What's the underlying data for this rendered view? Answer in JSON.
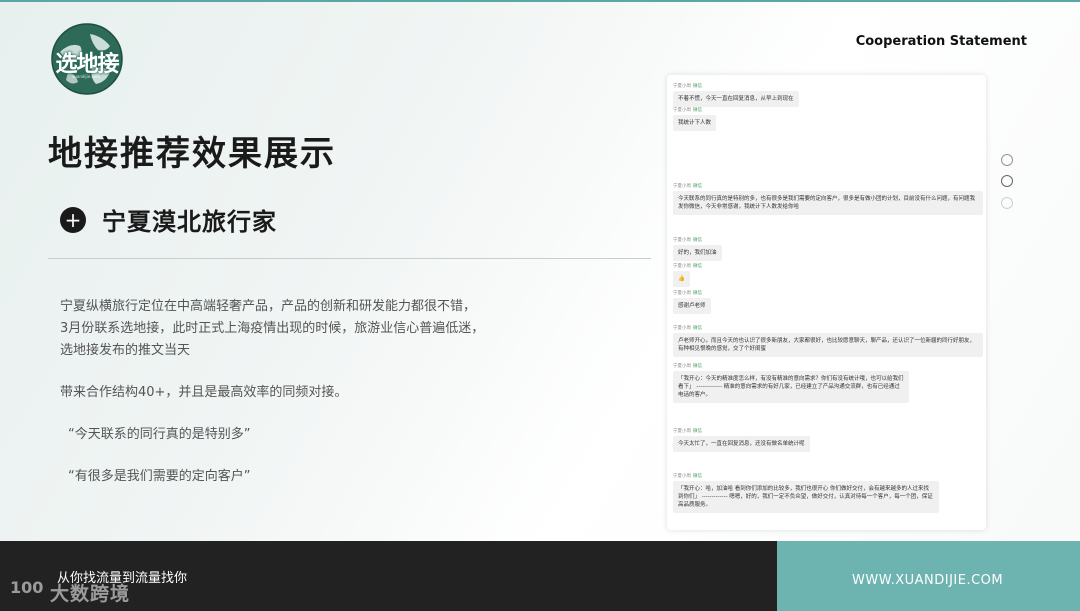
{
  "brand": {
    "logo_text": "选地接",
    "logo_subtext": "xuandijie.com",
    "colors": {
      "accent": "#6db3b0",
      "logo_green": "#2d6a58",
      "footer_dark": "#222222"
    }
  },
  "header": {
    "statement": "Cooperation Statement"
  },
  "main": {
    "title": "地接推荐效果展示",
    "subtitle": "宁夏漠北旅行家",
    "subtitle_icon": "plus-icon",
    "paragraphs": [
      "宁夏纵横旅行定位在中高端轻奢产品，产品的创新和研发能力都很不错，",
      "3月份联系选地接，此时正式上海疫情出现的时候，旅游业信心普遍低迷，",
      "选地接发布的推文当天"
    ],
    "summary": "带来合作结构40+，并且是最高效率的同频对接。",
    "quotes": [
      "“今天联系的同行真的是特别多”",
      "“有很多是我们需要的定向客户”"
    ]
  },
  "chat": {
    "messages": [
      {
        "sender": "宁夏小周",
        "tag": "微信",
        "text": "不着不慌，今天一直在回复消息，从早上到现在"
      },
      {
        "sender": "宁夏小周",
        "tag": "微信",
        "text": "我统计下人数"
      },
      {
        "sender": "宁夏小周",
        "tag": "微信",
        "text": "今天联系的同行真的是特别的多，也有很多是我们需要的定向客户，很多是有做小团的计划，目前没有什么问题，有问题我发你微信，今天非常感谢，我统计下人数发给你哈"
      },
      {
        "sender": "宁夏小周",
        "tag": "微信",
        "text": "好的，我们加油"
      },
      {
        "sender": "宁夏小周",
        "tag": "微信",
        "text": "👍"
      },
      {
        "sender": "宁夏小周",
        "tag": "微信",
        "text": "感谢卢老师"
      },
      {
        "sender": "宁夏小周",
        "tag": "微信",
        "text": "卢老师开心，而且今天的也认识了很多新朋友，大家都很好，也比较愿意聊天，聊产品，还认识了一位新疆的同行好朋友，有种相见恨晚的感觉，交了个好闺蜜"
      },
      {
        "sender": "宁夏小周",
        "tag": "微信",
        "text": "「我开心：今天的精准度怎么样，有没有精准的意向需求？你们有没有统计哦，也可以给我们看下」 ------------- 精准的意向需求的有好几家，已经建立了产品沟通交流群，也有已经通过电话的客户。"
      },
      {
        "sender": "宁夏小周",
        "tag": "微信",
        "text": "今天太忙了，一直在回复消息，还没有做名单统计呢"
      },
      {
        "sender": "宁夏小周",
        "tag": "微信",
        "text": "「我开心：哈，加油哈 看到你们添加的比较多，我们也很开心 你们做好交付，会有越来越多的人过来找到你们」 ------------- 嗯嗯，好的，我们一定不负众望，做好交付，认真对待每一个客户，每一个团，保证高品质服务。"
      }
    ]
  },
  "pagination": {
    "count": 3,
    "active_index": 1
  },
  "footer": {
    "slogan": "从你找流量到流量找你",
    "website": "WWW.XUANDIJIE.COM",
    "watermark_logo": "100",
    "watermark_text": "大数跨境"
  }
}
